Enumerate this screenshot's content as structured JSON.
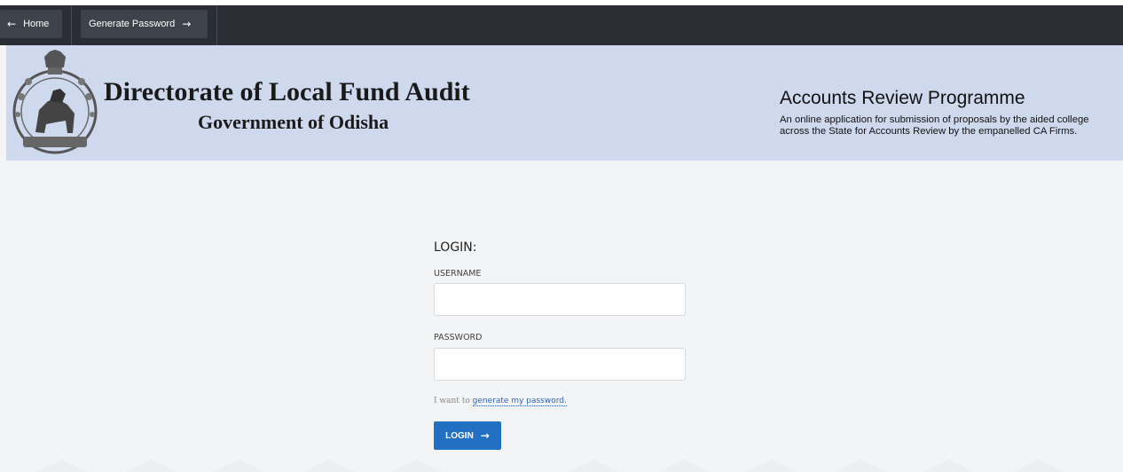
{
  "nav": {
    "home_label": "Home",
    "generate_label": "Generate Password"
  },
  "header": {
    "title": "Directorate of Local Fund Audit",
    "subtitle": "Government of Odisha",
    "program_title": "Accounts Review Programme",
    "program_line1": "An online application for submission of proposals by the aided college",
    "program_line2": "across the State for  Accounts Review by the empanelled CA Firms."
  },
  "login": {
    "heading": "LOGIN:",
    "username_label": "USERNAME",
    "username_value": "",
    "password_label": "PASSWORD",
    "password_value": "",
    "helper_prefix": "I want to",
    "helper_link": "generate my password.",
    "button_label": "LOGIN"
  },
  "colors": {
    "topbar": "#2a2d33",
    "header_bg": "#cfd9ee",
    "accent": "#2270c4"
  }
}
